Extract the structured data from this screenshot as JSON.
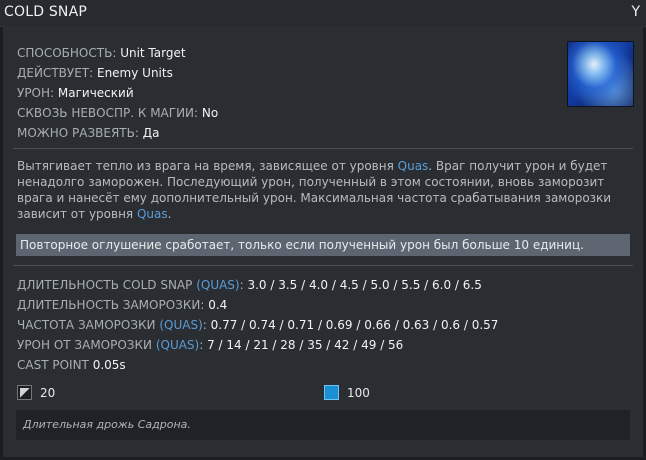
{
  "header": {
    "title": "COLD SNAP",
    "hotkey": "Y"
  },
  "ability": {
    "stats": [
      {
        "label": "СПОСОБНОСТЬ:",
        "value": "Unit Target"
      },
      {
        "label": "ДЕЙСТВУЕТ:",
        "value": "Enemy Units"
      },
      {
        "label": "УРОН:",
        "value": "Магический"
      },
      {
        "label": "СКВОЗЬ НЕВОСПР. К МАГИИ:",
        "value": "No"
      },
      {
        "label": "МОЖНО РАЗВЕЯТЬ:",
        "value": "Да"
      }
    ],
    "icon": "cold-snap-ability-icon"
  },
  "description": {
    "p1": "Вытягивает тепло из врага на время, зависящее от уровня ",
    "quas1": "Quas",
    "p2": ". Враг получит урон и будет ненадолго заморожен. Последующий урон, полученный в этом состоянии, вновь заморозит врага и нанесёт ему дополнительный урон. Максимальная частота срабатывания заморозки зависит от уровня ",
    "quas2": "Quas",
    "p3": "."
  },
  "note": "Повторное оглушение сработает, только если полученный урон был больше 10 единиц.",
  "levels": {
    "duration": {
      "label": "ДЛИТЕЛЬНОСТЬ COLD SNAP ",
      "quas": "(QUAS)",
      "colon": ": ",
      "value": "3.0 / 3.5 / 4.0 / 4.5 / 5.0 / 5.5 / 6.0 / 6.5"
    },
    "freeze_duration": {
      "label": "ДЛИТЕЛЬНОСТЬ ЗАМОРОЗКИ: ",
      "value": "0.4"
    },
    "freeze_rate": {
      "label": "ЧАСТОТА ЗАМОРОЗКИ ",
      "quas": "(QUAS)",
      "colon": ": ",
      "value": "0.77 / 0.74 / 0.71 / 0.69 / 0.66 / 0.63 / 0.6 / 0.57"
    },
    "freeze_damage": {
      "label": "УРОН ОТ ЗАМОРОЗКИ ",
      "quas": "(QUAS)",
      "colon": ": ",
      "value": "7 / 14 / 21 / 28 / 35 / 42 / 49 / 56"
    },
    "cast_point": {
      "label": "CAST POINT ",
      "value": "0.05s"
    }
  },
  "costs": {
    "cooldown": "20",
    "mana": "100",
    "cooldown_icon": "cooldown-icon",
    "mana_icon": "mana-icon",
    "mana_color": "#1b8fd6"
  },
  "lore": "Длительная дрожь Садрона."
}
